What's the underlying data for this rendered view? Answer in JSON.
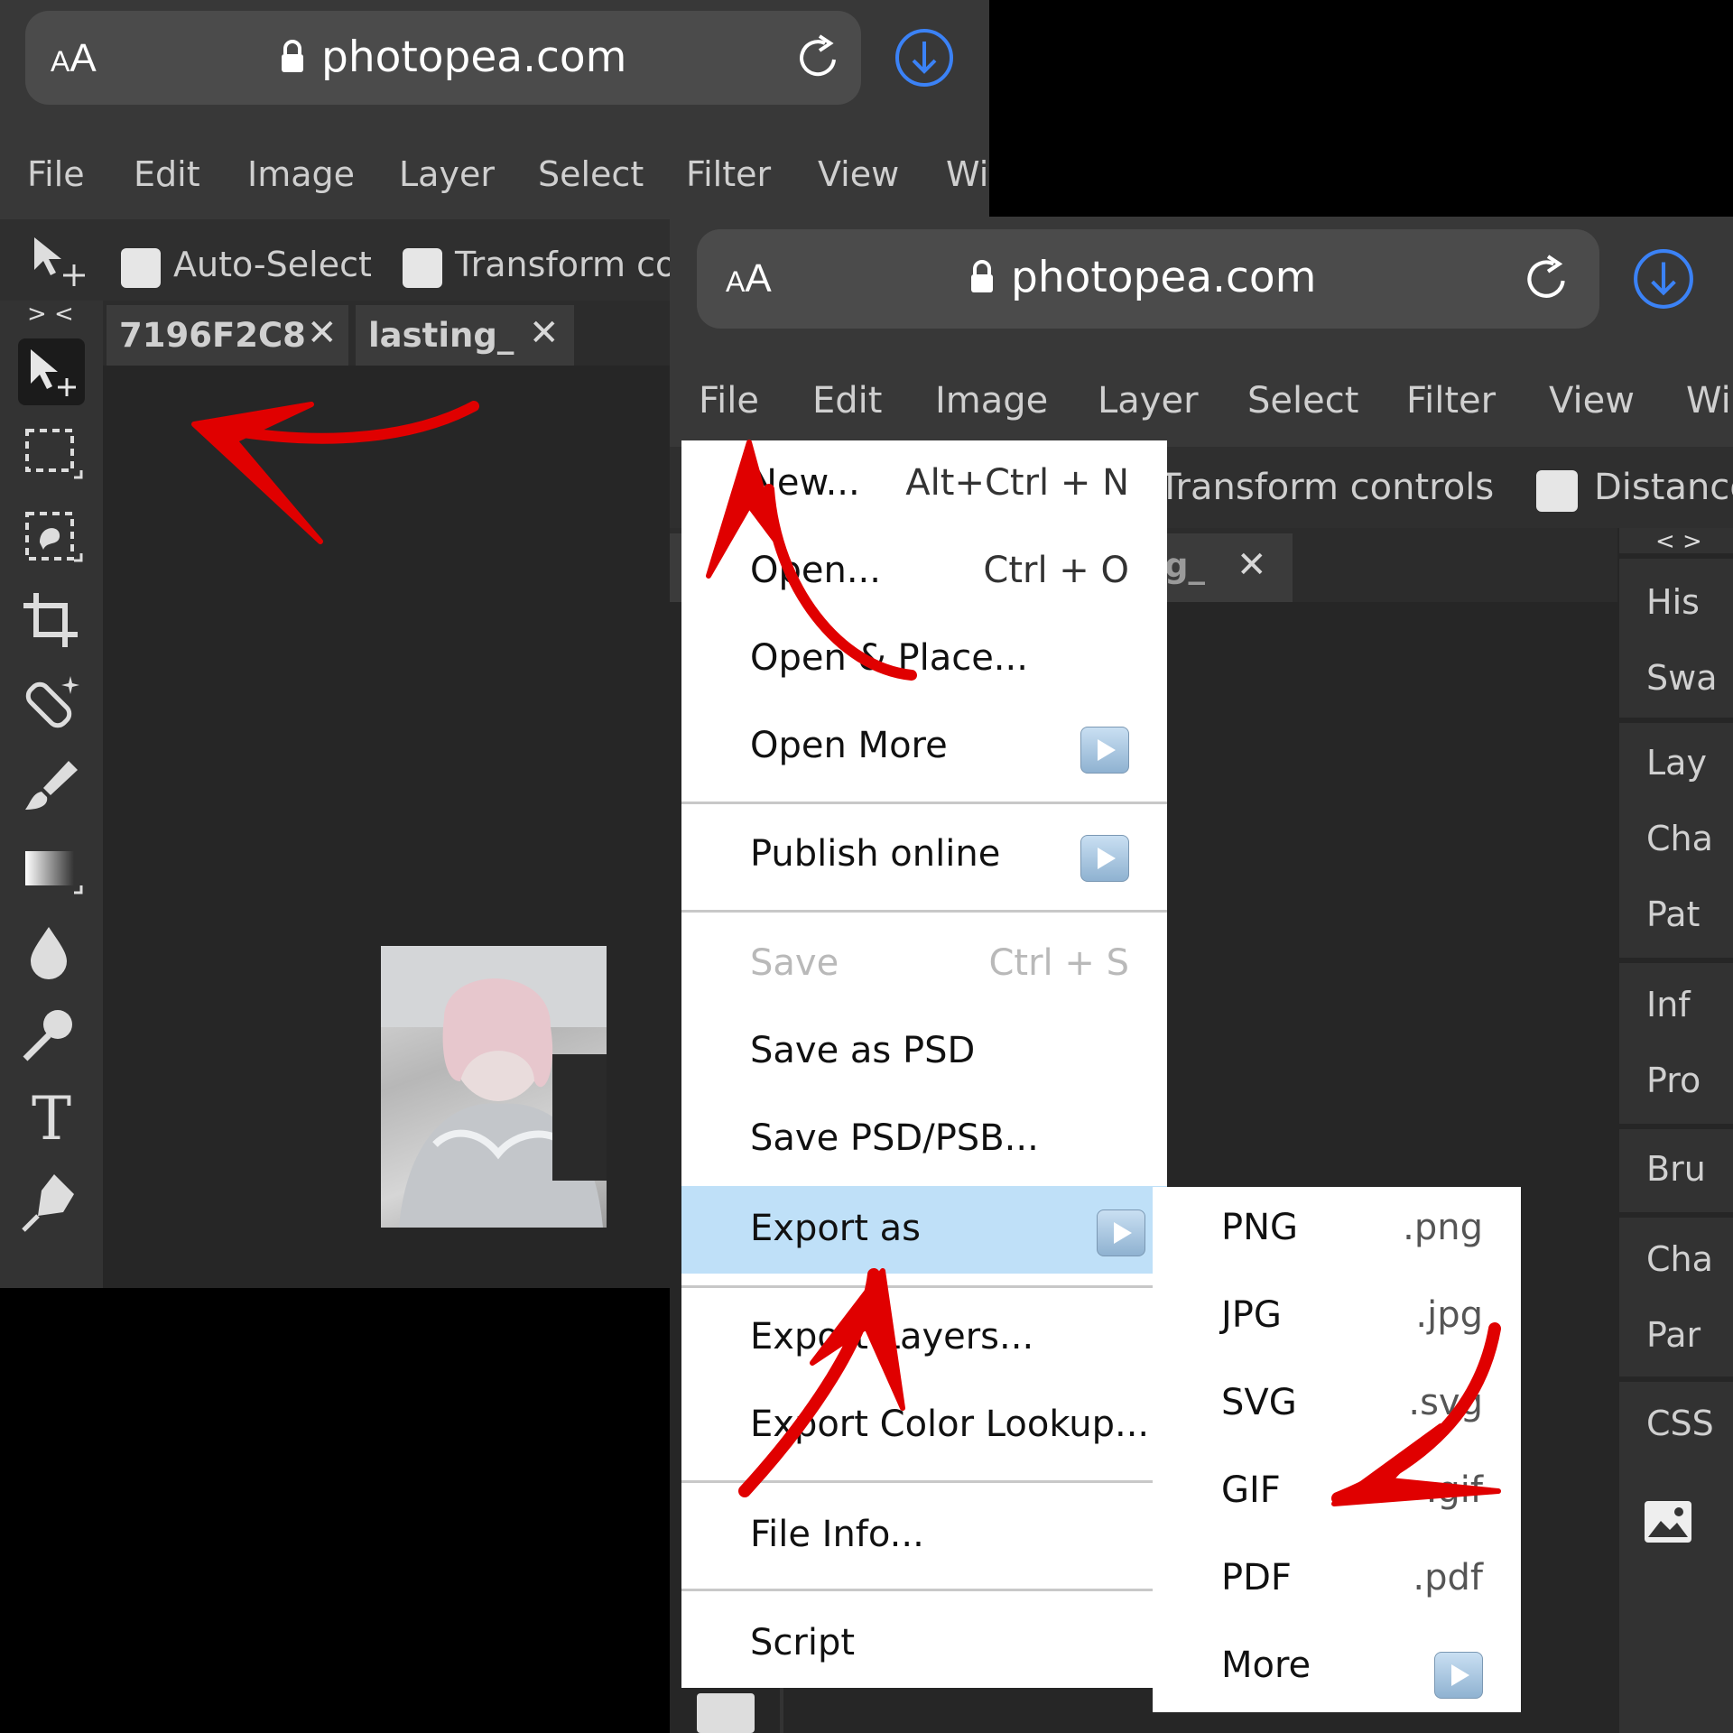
{
  "colors": {
    "toolbar_bg": "#383838",
    "canvas_bg": "#262626",
    "menu_highlight": "#bfe0f8",
    "browser_accent": "#3b82f6",
    "annotation_red": "#e00000"
  },
  "screen1": {
    "browser": {
      "aa_small": "A",
      "aa_big": "A",
      "domain": "photopea.com"
    },
    "menu": [
      "File",
      "Edit",
      "Image",
      "Layer",
      "Select",
      "Filter",
      "View",
      "Wi"
    ],
    "options": {
      "auto_select": "Auto-Select",
      "transform": "Transform co"
    },
    "collapse_toggle": "> <",
    "tabs": [
      {
        "label": "7196F2C8",
        "close": "✕"
      },
      {
        "label": "lasting_",
        "close": "✕"
      }
    ],
    "tools": [
      "move-tool-icon",
      "rect-select-tool-icon",
      "lasso-select-tool-icon",
      "crop-tool-icon",
      "healing-tool-icon",
      "brush-tool-icon",
      "gradient-tool-icon",
      "blur-tool-icon",
      "dodge-tool-icon",
      "type-tool-icon",
      "pen-tool-icon"
    ],
    "type_tool_glyph": "T"
  },
  "screen2": {
    "browser": {
      "aa_small": "A",
      "aa_big": "A",
      "domain": "photopea.com"
    },
    "menu": [
      "File",
      "Edit",
      "Image",
      "Layer",
      "Select",
      "Filter",
      "View",
      "Wi"
    ],
    "options": {
      "transform": "Transform controls",
      "distance": "Distance"
    },
    "tab": {
      "label": "g_",
      "close": "✕"
    },
    "panel_toggle": "< >",
    "panel_groups": [
      [
        "His",
        "Swa"
      ],
      [
        "Lay",
        "Cha",
        "Pat"
      ],
      [
        "Inf",
        "Pro"
      ],
      [
        "Bru"
      ],
      [
        "Cha",
        "Par"
      ],
      [
        "CSS"
      ]
    ]
  },
  "file_menu": {
    "items": [
      {
        "label": "New...",
        "shortcut": "Alt+Ctrl + N"
      },
      {
        "label": "Open...",
        "shortcut": "Ctrl + O"
      },
      {
        "label": "Open & Place...",
        "shortcut": ""
      },
      {
        "label": "Open More",
        "submenu": true
      },
      {
        "label": "Publish online",
        "submenu": true
      },
      {
        "label": "Save",
        "shortcut": "Ctrl + S",
        "disabled": true
      },
      {
        "label": "Save as PSD",
        "shortcut": ""
      },
      {
        "label": "Save PSD/PSB...",
        "shortcut": ""
      },
      {
        "label": "Export as",
        "submenu": true,
        "highlighted": true
      },
      {
        "label": "Export Layers...",
        "shortcut": ""
      },
      {
        "label": "Export Color Lookup...",
        "shortcut": ""
      },
      {
        "label": "File Info...",
        "shortcut": ""
      },
      {
        "label": "Script",
        "shortcut": ""
      }
    ]
  },
  "export_submenu": {
    "items": [
      {
        "label": "PNG",
        "ext": ".png"
      },
      {
        "label": "JPG",
        "ext": ".jpg"
      },
      {
        "label": "SVG",
        "ext": ".svg"
      },
      {
        "label": "GIF",
        "ext": ".gif"
      },
      {
        "label": "PDF",
        "ext": ".pdf"
      },
      {
        "label": "More",
        "submenu": true
      }
    ]
  }
}
